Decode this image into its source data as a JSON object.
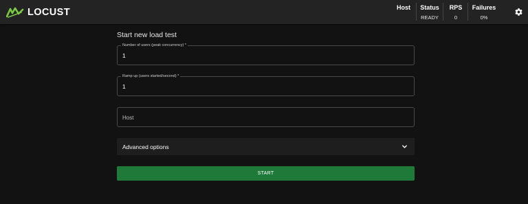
{
  "header": {
    "brand": "LOCUST",
    "stats": [
      {
        "label": "Host",
        "value": ""
      },
      {
        "label": "Status",
        "value": "READY"
      },
      {
        "label": "RPS",
        "value": "0"
      },
      {
        "label": "Failures",
        "value": "0%"
      }
    ],
    "settings_icon": "gear-icon"
  },
  "form": {
    "title": "Start new load test",
    "users": {
      "label": "Number of users (peak concurrency) *",
      "value": "1"
    },
    "ramp": {
      "label": "Ramp up (users started/second) *",
      "value": "1"
    },
    "host": {
      "placeholder": "Host"
    },
    "advanced_label": "Advanced options",
    "start_label": "START"
  },
  "colors": {
    "accent": "#1f7a3a",
    "brand_green": "#7ac943",
    "background": "#121212",
    "topbar": "#232323"
  }
}
